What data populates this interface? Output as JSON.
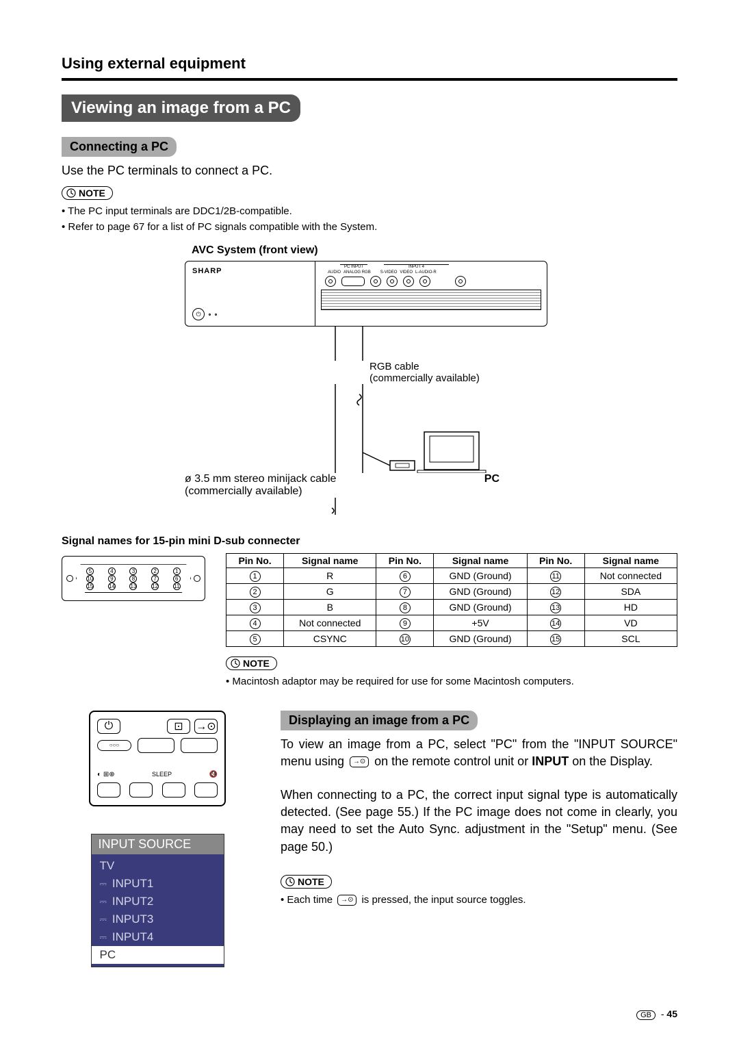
{
  "section_title": "Using external equipment",
  "main_header": "Viewing an image from a PC",
  "connecting": {
    "heading": "Connecting a PC",
    "intro": "Use the PC terminals to connect a PC.",
    "note_label": "NOTE",
    "notes": [
      "The PC input terminals are DDC1/2B-compatible.",
      "Refer to page 67 for a list of PC signals compatible with the System."
    ]
  },
  "avc": {
    "caption": "AVC System (front view)",
    "brand": "SHARP",
    "port_group_left": "PC INPUT",
    "port_group_right": "INPUT 4",
    "port_labels": [
      "AUDIO",
      "ANALOG RGB",
      "S-VIDEO",
      "VIDEO",
      "L-AUDIO-R"
    ],
    "rgb_cable": "RGB cable",
    "rgb_note": "(commercially available)",
    "minijack": "ø 3.5 mm stereo minijack cable",
    "minijack_note": "(commercially available)",
    "pc_label": "PC"
  },
  "signal": {
    "title": "Signal names for 15-pin mini D-sub connecter",
    "headers": [
      "Pin No.",
      "Signal name",
      "Pin No.",
      "Signal name",
      "Pin No.",
      "Signal name"
    ],
    "rows": [
      [
        "1",
        "R",
        "6",
        "GND (Ground)",
        "11",
        "Not connected"
      ],
      [
        "2",
        "G",
        "7",
        "GND (Ground)",
        "12",
        "SDA"
      ],
      [
        "3",
        "B",
        "8",
        "GND (Ground)",
        "13",
        "HD"
      ],
      [
        "4",
        "Not connected",
        "9",
        "+5V",
        "14",
        "VD"
      ],
      [
        "5",
        "CSYNC",
        "10",
        "GND (Ground)",
        "15",
        "SCL"
      ]
    ],
    "dsub_rows": [
      [
        "5",
        "4",
        "3",
        "2",
        "1"
      ],
      [
        "10",
        "9",
        "8",
        "7",
        "6"
      ],
      [
        "15",
        "14",
        "13",
        "12",
        "11"
      ]
    ],
    "note_label": "NOTE",
    "note": "Macintosh adaptor may be required for use for some Macintosh computers."
  },
  "remote": {
    "sleep_label": "SLEEP"
  },
  "input_source": {
    "title": "INPUT SOURCE",
    "items": [
      "TV",
      "INPUT1",
      "INPUT2",
      "INPUT3",
      "INPUT4",
      "PC"
    ],
    "highlighted": "PC"
  },
  "displaying": {
    "heading": "Displaying an image from a PC",
    "para1_a": "To view an image from a PC, select \"PC\" from the \"INPUT SOURCE\" menu using ",
    "para1_b": " on the remote control unit or ",
    "para1_c": "INPUT",
    "para1_d": " on the Display.",
    "para2": "When connecting to a PC, the correct input signal type is automatically detected. (See page 55.) If the PC image does not come in clearly, you may need to set the Auto Sync. adjustment in the \"Setup\" menu. (See page 50.)",
    "note_label": "NOTE",
    "note_a": "Each time ",
    "note_b": " is pressed, the input source toggles."
  },
  "footer": {
    "region": "GB",
    "page": "45"
  }
}
